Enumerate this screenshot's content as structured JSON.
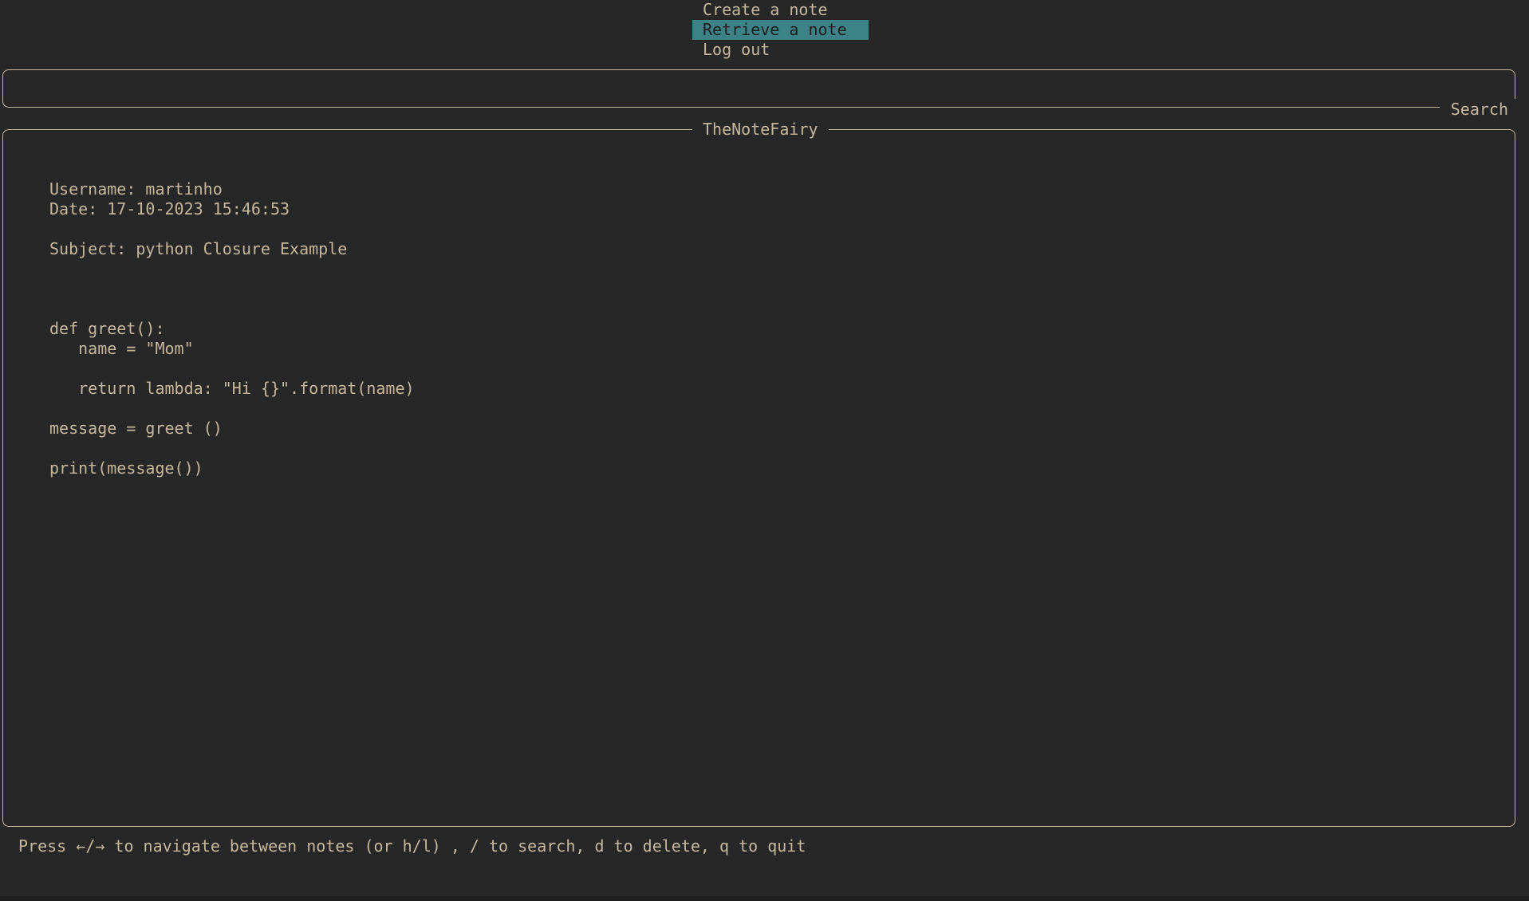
{
  "menu": {
    "items": [
      {
        "label": "Create a note",
        "selected": false
      },
      {
        "label": "Retrieve a note",
        "selected": true
      },
      {
        "label": "Log out",
        "selected": false
      }
    ]
  },
  "search": {
    "label": "Search",
    "value": ""
  },
  "note": {
    "panel_title": "TheNoteFairy",
    "username_line": "Username: martinho",
    "date_line": "Date: 17-10-2023 15:46:53",
    "subject_line": "Subject: python Closure Example",
    "body_lines": [
      "",
      "",
      "",
      "def greet():",
      "   name = \"Mom\"",
      "",
      "   return lambda: \"Hi {}\".format(name)",
      "",
      "message = greet ()",
      "",
      "print(message())"
    ]
  },
  "footer": {
    "help_text": "Press ←/→ to navigate between notes (or h/l) , / to search, d to delete, q to quit"
  },
  "colors": {
    "background": "#272727",
    "text": "#c6b79c",
    "selection": "#3d8287"
  }
}
